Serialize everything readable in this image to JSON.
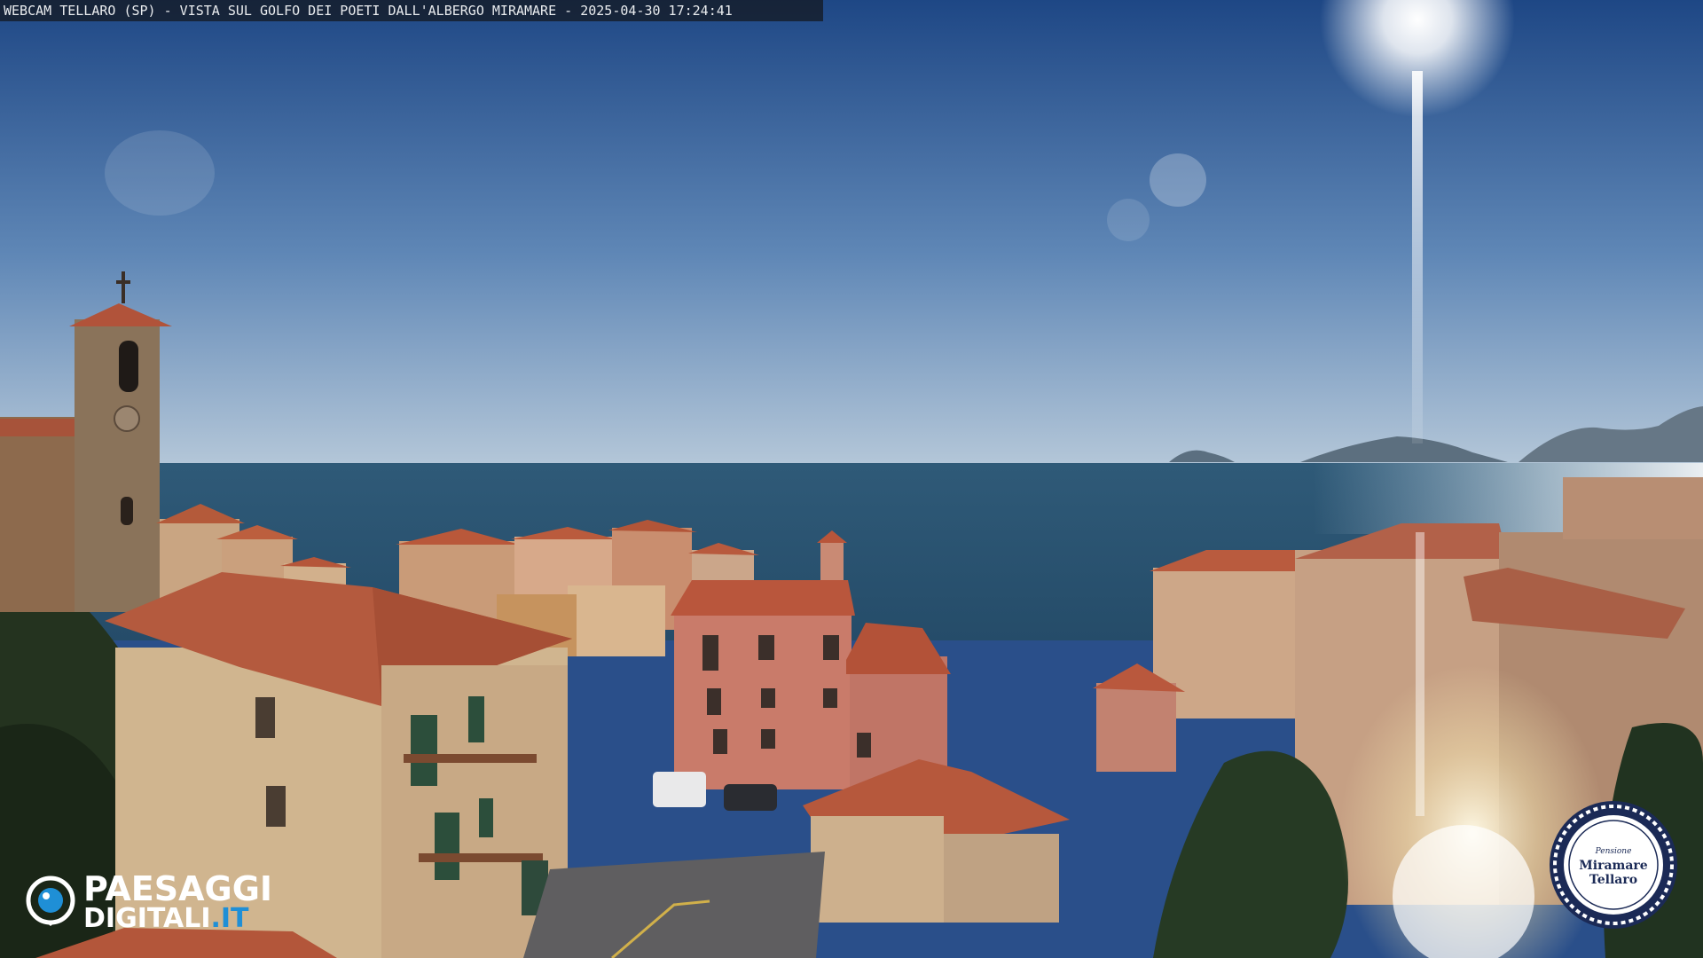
{
  "overlay": {
    "caption": "WEBCAM TELLARO (SP) - VISTA SUL GOLFO DEI POETI DALL'ALBERGO MIRAMARE - 2025-04-30 17:24:41"
  },
  "watermark_left": {
    "brand_line1": "PAESAGGI",
    "brand_line2": "DIGITALI",
    "brand_suffix": ".IT",
    "accent_color": "#1f8fd6"
  },
  "watermark_right": {
    "script_line": "Pensione",
    "name_line1": "Miramare",
    "name_line2": "Tellaro",
    "ring_color": "#1b2a56"
  },
  "scene": {
    "sky_top": "#1f4a8f",
    "sky_horizon": "#a9c0d6",
    "sea": "#2c5776",
    "roof": "#b85a3b"
  }
}
